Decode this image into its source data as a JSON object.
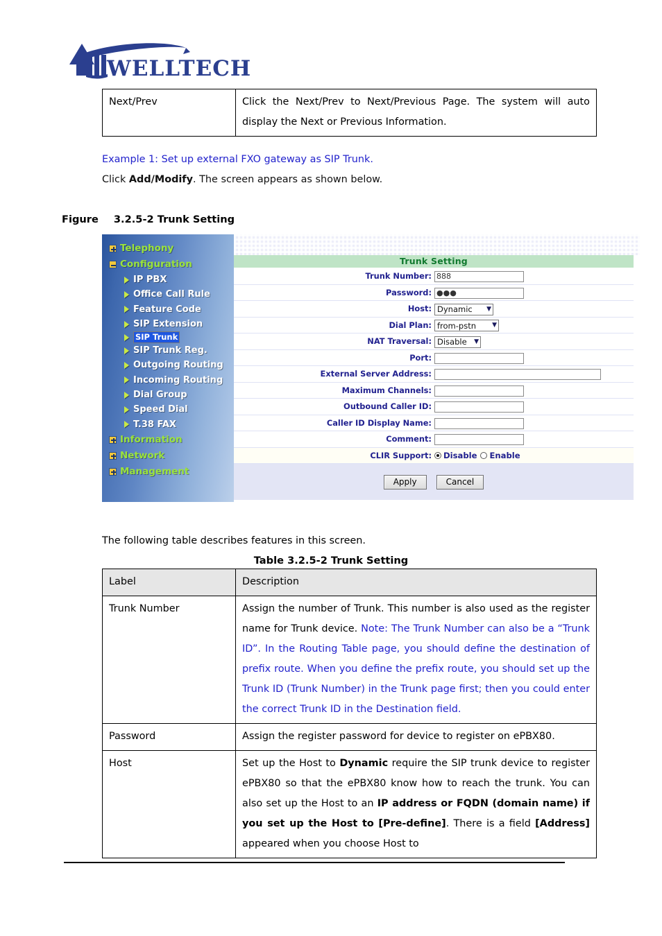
{
  "brand": {
    "name": "WELLTECH",
    "logo_color": "#2b3f8f"
  },
  "top_table": {
    "rows": [
      {
        "label": "Next/Prev",
        "desc": "Click the Next/Prev to Next/Previous Page. The system will auto display the Next or Previous Information."
      }
    ]
  },
  "body": {
    "example_line": "Example 1: Set up external FXO gateway as SIP Trunk.",
    "click_line_pre": "Click ",
    "click_line_bold": "Add/Modify",
    "click_line_post": ". The screen appears as shown below.",
    "figure_label": "Figure",
    "figure_caption": "3.2.5-2 Trunk Setting",
    "follow_line": "The following table describes features in this screen.",
    "table_caption": "Table 3.2.5-2 Trunk Setting"
  },
  "screenshot": {
    "sidebar": {
      "groups": [
        {
          "label": "Telephony",
          "state": "collapsed",
          "icon": "plus-box-icon"
        },
        {
          "label": "Configuration",
          "state": "expanded",
          "icon": "minus-box-icon"
        }
      ],
      "items": [
        {
          "label": "IP PBX",
          "selected": false
        },
        {
          "label": "Office Call Rule",
          "selected": false
        },
        {
          "label": "Feature Code",
          "selected": false
        },
        {
          "label": "SIP Extension",
          "selected": false
        },
        {
          "label": "SIP Trunk",
          "selected": true
        },
        {
          "label": "SIP Trunk Reg.",
          "selected": false
        },
        {
          "label": "Outgoing Routing",
          "selected": false
        },
        {
          "label": "Incoming Routing",
          "selected": false
        },
        {
          "label": "Dial Group",
          "selected": false
        },
        {
          "label": "Speed Dial",
          "selected": false
        },
        {
          "label": "T.38 FAX",
          "selected": false
        }
      ],
      "tail_groups": [
        {
          "label": "Information",
          "state": "collapsed",
          "icon": "plus-box-icon"
        },
        {
          "label": "Network",
          "state": "collapsed",
          "icon": "plus-box-icon"
        },
        {
          "label": "Management",
          "state": "collapsed",
          "icon": "plus-box-icon"
        }
      ]
    },
    "form": {
      "title": "Trunk Setting",
      "fields": {
        "trunk_number": {
          "label": "Trunk Number:",
          "value": "888"
        },
        "password": {
          "label": "Password:",
          "value": "●●●"
        },
        "host": {
          "label": "Host:",
          "value": "Dynamic"
        },
        "dial_plan": {
          "label": "Dial Plan:",
          "value": "from-pstn"
        },
        "nat_traversal": {
          "label": "NAT Traversal:",
          "value": "Disable"
        },
        "port": {
          "label": "Port:",
          "value": ""
        },
        "external_server_address": {
          "label": "External Server Address:",
          "value": ""
        },
        "maximum_channels": {
          "label": "Maximum Channels:",
          "value": ""
        },
        "outbound_caller_id": {
          "label": "Outbound Caller ID:",
          "value": ""
        },
        "caller_id_display_name": {
          "label": "Caller ID Display Name:",
          "value": ""
        },
        "comment": {
          "label": "Comment:",
          "value": ""
        },
        "clir_support": {
          "label": "CLIR Support:",
          "options": [
            "Disable",
            "Enable"
          ],
          "selected": "Disable"
        }
      },
      "buttons": {
        "apply": "Apply",
        "cancel": "Cancel"
      }
    },
    "colors": {
      "title_bg": "#bfe4c6",
      "title_text": "#117a2f",
      "label_text": "#21218f",
      "sidebar_group_text": "#9be33c",
      "sidebar_item_text": "#ffffff",
      "selection_bg": "#1e56e0",
      "footer_bg": "#e3e5f5"
    }
  },
  "bottom_table": {
    "headers": {
      "label": "Label",
      "description": "Description"
    },
    "rows": [
      {
        "label": "Trunk Number",
        "desc_black": "Assign the number of Trunk. This number is also used as the register name for Trunk device.",
        "desc_blue": "Note: The Trunk Number can also be a “Trunk ID”. In the Routing Table page, you should define the destination of prefix route. When you define the prefix route, you should set up the Trunk ID (Trunk Number) in the Trunk page first; then you could enter the correct Trunk ID in the Destination field."
      },
      {
        "label": "Password",
        "desc_black": "Assign the register password for device to register on ePBX80.",
        "desc_blue": ""
      },
      {
        "label": "Host",
        "desc_parts": [
          {
            "t": "Set up the Host to ",
            "b": false
          },
          {
            "t": "Dynamic",
            "b": true
          },
          {
            "t": " require the SIP trunk device to register ePBX80 so that the ePBX80 know how to reach the trunk. You can also set up the Host to an ",
            "b": false
          },
          {
            "t": "IP address or FQDN (domain name) if you set up the Host to [Pre-define]",
            "b": true
          },
          {
            "t": ". There is a field ",
            "b": false
          },
          {
            "t": "[Address]",
            "b": true
          },
          {
            "t": " appeared when you choose Host to",
            "b": false
          }
        ]
      }
    ]
  }
}
